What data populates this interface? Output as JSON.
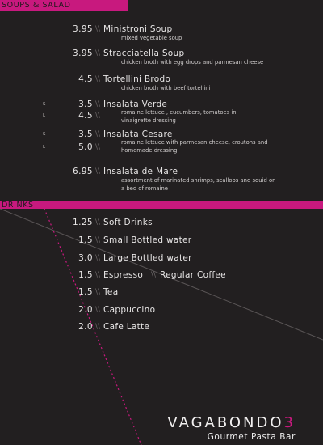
{
  "sections": {
    "soups_title": "SOUPS & SALAD",
    "drinks_title": "DRINKS"
  },
  "separator": "\\\\",
  "soups": [
    {
      "price": "3.95",
      "name": "Ministroni Soup",
      "desc": "mixed vegetable soup"
    },
    {
      "price": "3.95",
      "name": "Stracciatella Soup",
      "desc": "chicken broth with egg drops and parmesan cheese"
    },
    {
      "price": "4.5",
      "name": "Tortellini Brodo",
      "desc": "chicken broth with beef tortellini"
    },
    {
      "size_s": "S",
      "price_s": "3.5",
      "size_l": "L",
      "price_l": "4.5",
      "name": "Insalata Verde",
      "desc": "romaine lettuce , cucumbers, tomatoes in vinaigrette dressing"
    },
    {
      "size_s": "S",
      "price_s": "3.5",
      "size_l": "L",
      "price_l": "5.0",
      "name": "Insalata Cesare",
      "desc": "romaine lettuce with parmesan cheese, croutons and homemade dressing"
    },
    {
      "price": "6.95",
      "name": "Insalata de Mare",
      "desc": "assortment of marinated shrimps, scallops and squid on a bed of romaine"
    }
  ],
  "drinks": [
    {
      "price": "1.25",
      "name": "Soft Drinks"
    },
    {
      "price": "1.5",
      "name": "Small Bottled water"
    },
    {
      "price": "3.0",
      "name": "Large Bottled water"
    },
    {
      "price": "1.5",
      "name": "Espresso",
      "name2": "Regular Coffee"
    },
    {
      "price": "1.5",
      "name": "Tea"
    },
    {
      "price": "2.0",
      "name": "Cappuccino"
    },
    {
      "price": "2.0",
      "name": "Cafe Latte"
    }
  ],
  "brand": {
    "name_a": "VAGA",
    "name_b": "BONDO",
    "name_num": "3",
    "tagline": "Gourmet Pasta Bar"
  },
  "colors": {
    "background": "#221f20",
    "accent": "#c8197e"
  }
}
